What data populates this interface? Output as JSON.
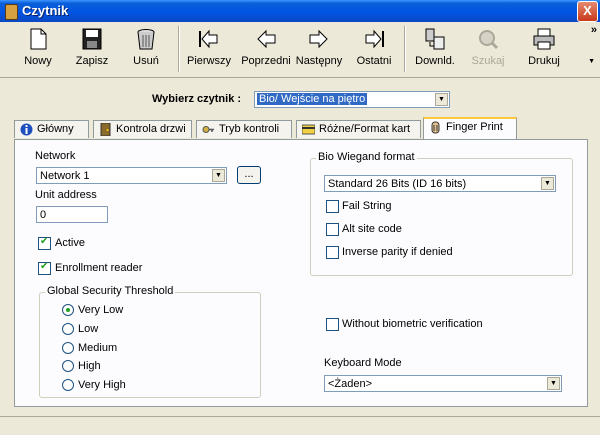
{
  "window": {
    "title": "Czytnik",
    "close_label": "X"
  },
  "toolbar": {
    "buttons": [
      {
        "label": "Nowy",
        "icon": "new-document-icon"
      },
      {
        "label": "Zapisz",
        "icon": "save-floppy-icon"
      },
      {
        "label": "Usuń",
        "icon": "trash-bin-icon"
      },
      {
        "label": "Pierwszy",
        "icon": "first-record-icon"
      },
      {
        "label": "Poprzedni",
        "icon": "previous-arrow-icon"
      },
      {
        "label": "Następny",
        "icon": "next-arrow-icon"
      },
      {
        "label": "Ostatni",
        "icon": "last-record-icon"
      },
      {
        "label": "Downld.",
        "icon": "download-device-icon"
      },
      {
        "label": "Szukaj",
        "icon": "search-icon",
        "disabled": true
      },
      {
        "label": "Drukuj",
        "icon": "printer-icon"
      }
    ],
    "overflow": "»"
  },
  "reader_selector": {
    "label": "Wybierz czytnik :",
    "value": "Bio/ Wejście na piętro"
  },
  "tabs": [
    {
      "label": "Główny",
      "icon": "info-icon"
    },
    {
      "label": "Kontrola drzwi",
      "icon": "door-icon"
    },
    {
      "label": "Tryb kontroli",
      "icon": "key-icon"
    },
    {
      "label": "Różne/Format kart",
      "icon": "card-icon"
    },
    {
      "label": "Finger Print",
      "icon": "fingerprint-icon",
      "active": true
    }
  ],
  "finger_print": {
    "network": {
      "label": "Network",
      "value": "Network 1",
      "browse_label": "..."
    },
    "unit_address": {
      "label": "Unit address",
      "value": "0"
    },
    "active": {
      "label": "Active",
      "checked": true
    },
    "enrollment_reader": {
      "label": "Enrollment reader",
      "checked": true
    },
    "security_threshold": {
      "legend": "Global Security Threshold",
      "options": [
        "Very Low",
        "Low",
        "Medium",
        "High",
        "Very High"
      ],
      "selected": "Very Low"
    },
    "bio_wiegand": {
      "legend": "Bio Wiegand format",
      "format_value": "Standard 26 Bits (ID 16 bits)",
      "fail_string": {
        "label": "Fail String",
        "checked": false
      },
      "alt_site_code": {
        "label": "Alt site code",
        "checked": false
      },
      "inverse_parity": {
        "label": "Inverse parity if denied",
        "checked": false
      }
    },
    "without_biometric": {
      "label": "Without biometric verification",
      "checked": false
    },
    "keyboard_mode": {
      "label": "Keyboard Mode",
      "value": "<Żaden>"
    }
  },
  "colors": {
    "titlebar": "#0054e3",
    "window_bg": "#ece9d8",
    "panel_bg": "#fcfcfe",
    "selection": "#316ac5",
    "check": "#21a121",
    "tab_highlight": "#ffc83c"
  }
}
